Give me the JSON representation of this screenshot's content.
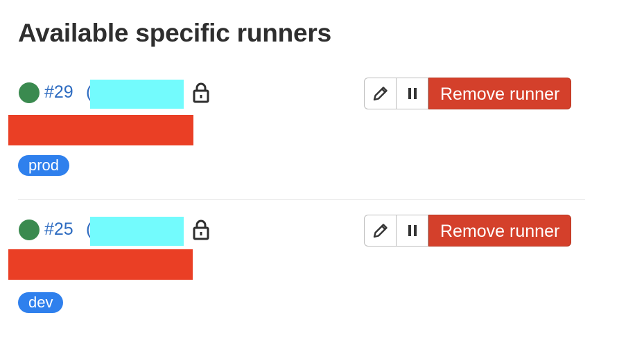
{
  "page": {
    "title": "Available specific runners"
  },
  "runners": [
    {
      "id_label": "#29",
      "status": "online",
      "status_color": "#3a8a4f",
      "locked": true,
      "tag": "prod",
      "actions": {
        "edit_icon": "pencil-icon",
        "pause_icon": "pause-icon",
        "remove_label": "Remove runner"
      }
    },
    {
      "id_label": "#25",
      "status": "online",
      "status_color": "#3a8a4f",
      "locked": true,
      "tag": "dev",
      "actions": {
        "edit_icon": "pencil-icon",
        "pause_icon": "pause-icon",
        "remove_label": "Remove runner"
      }
    }
  ],
  "colors": {
    "link": "#2e6cc1",
    "danger": "#d4402b",
    "tag": "#2f80ed",
    "redaction_cyan": "#73fbfd",
    "redaction_red": "#ea3f25"
  }
}
